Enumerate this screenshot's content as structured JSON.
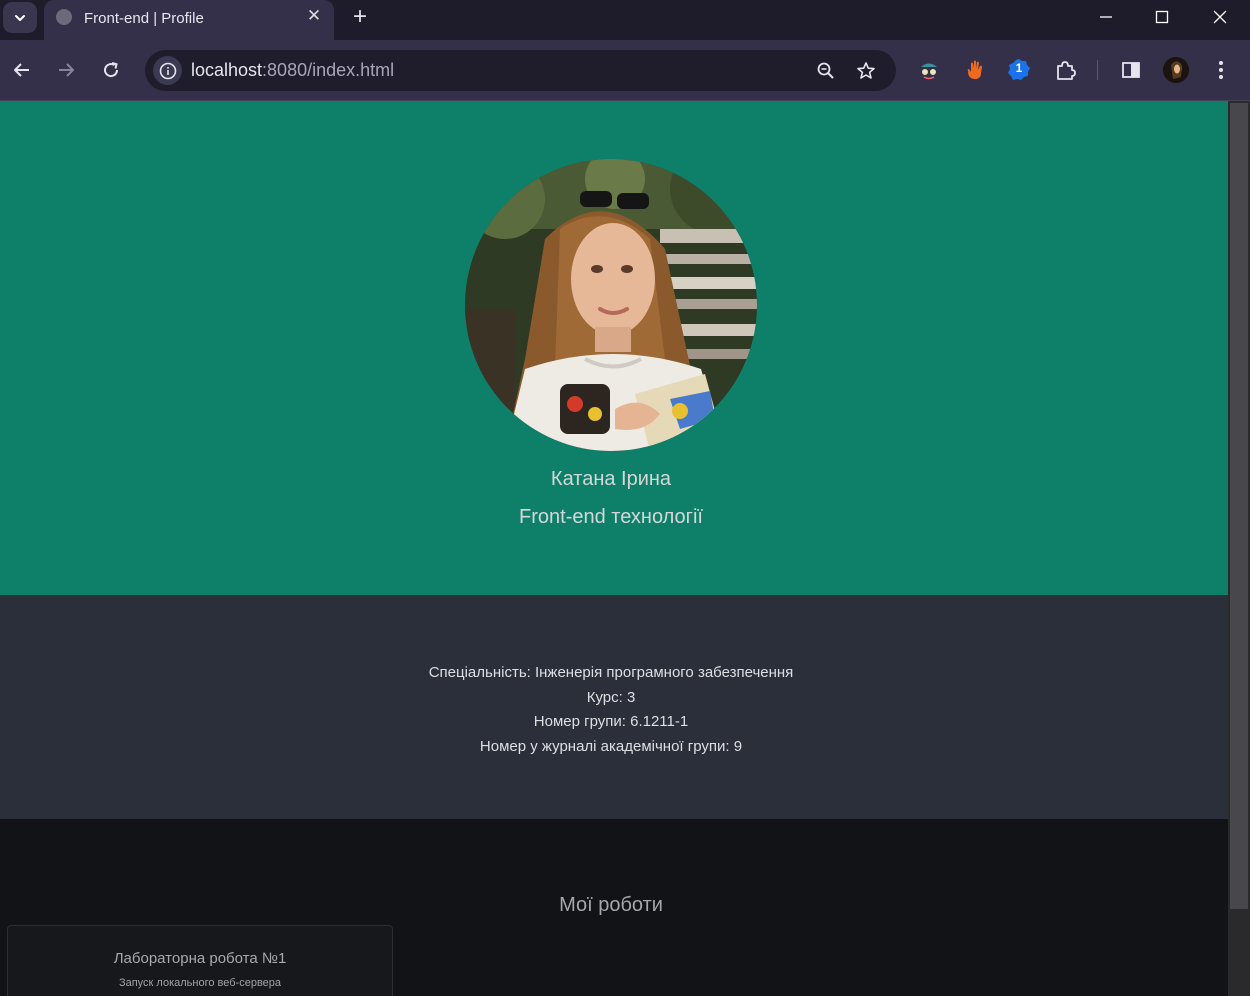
{
  "browser": {
    "tab_title": "Front-end | Profile",
    "tab_close_glyph": "✕",
    "new_tab_glyph": "+",
    "url_host": "localhost",
    "url_rest": ":8080/index.html",
    "extension_badge": "1",
    "icons": [
      "tab-search-icon",
      "back-icon",
      "forward-icon",
      "reload-icon",
      "site-info-icon",
      "zoom-icon",
      "bookmark-star-icon",
      "extension-icon",
      "side-panel-icon",
      "profile-avatar",
      "menu-icon",
      "minimize-icon",
      "maximize-icon",
      "close-icon"
    ]
  },
  "profile": {
    "name": "Катана Ірина",
    "subtitle": "Front-end технології",
    "info": [
      "Спеціальність: Інженерія програмного забезпечення",
      "Курс: 3",
      "Номер групи: 6.1211-1",
      "Номер у журналі академічної групи: 9"
    ]
  },
  "works": {
    "title": "Мої роботи",
    "cards": [
      {
        "title": "Лабораторна робота №1",
        "description": "Запуск локального веб-сервера"
      }
    ]
  },
  "colors": {
    "hero_bg": "#0e806a",
    "info_bg": "#2b2f3a",
    "works_bg": "#121316",
    "chrome_bg": "#34304a"
  }
}
